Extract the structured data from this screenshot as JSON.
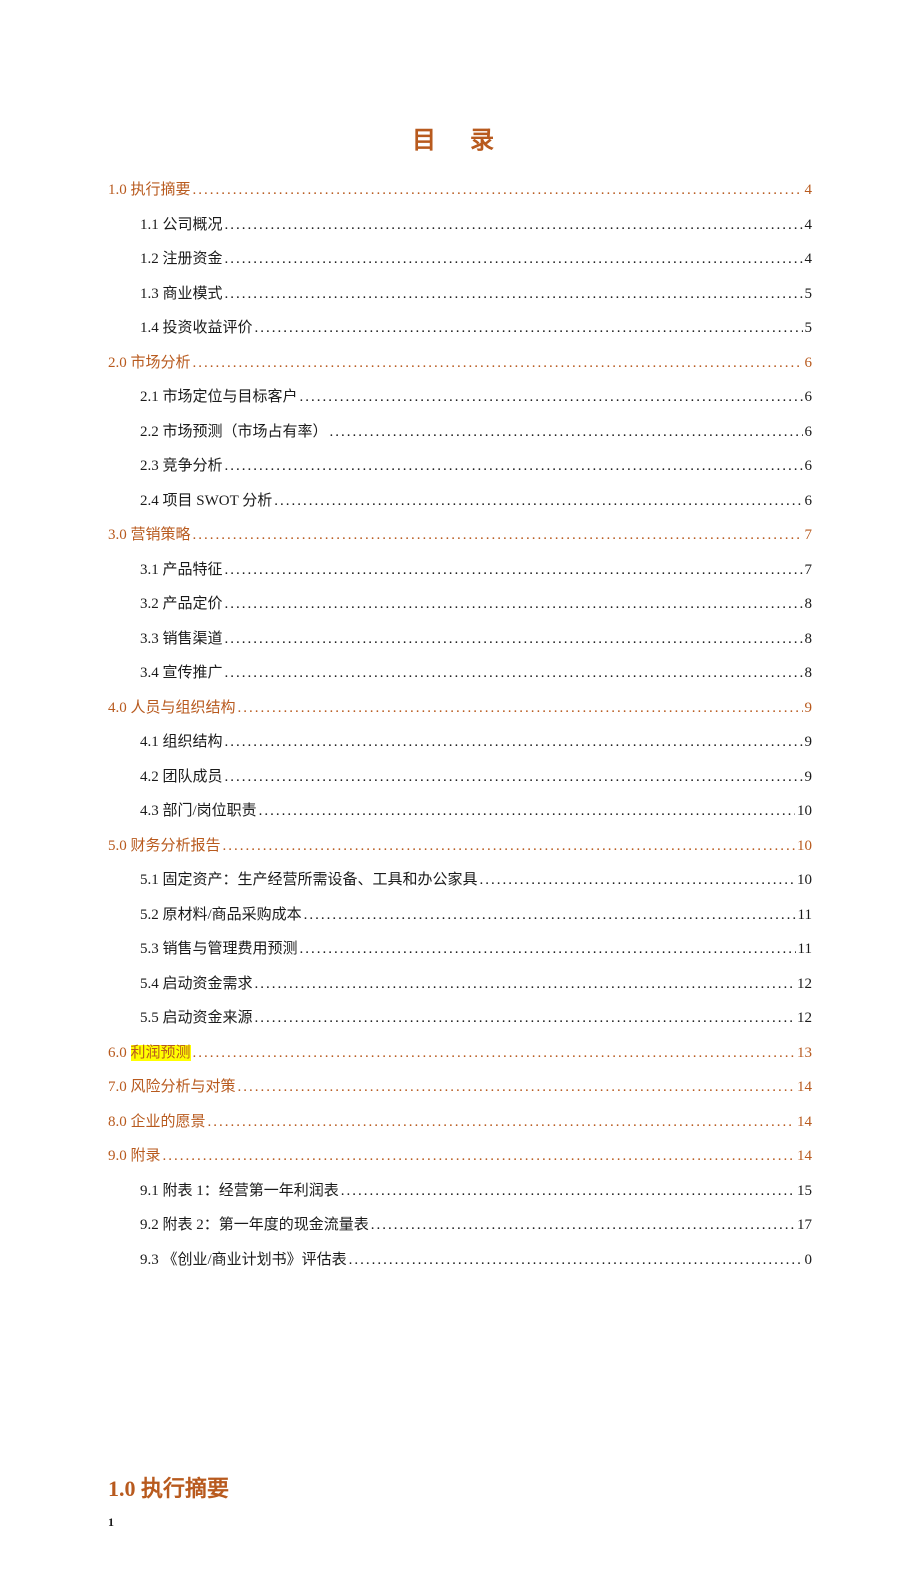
{
  "title": "目 录",
  "entries": [
    {
      "level": 1,
      "label": "1.0 执行摘要",
      "page": "4"
    },
    {
      "level": 2,
      "label": "1.1 公司概况",
      "page": "4"
    },
    {
      "level": 2,
      "label": "1.2 注册资金",
      "page": "4"
    },
    {
      "level": 2,
      "label": "1.3 商业模式",
      "page": "5"
    },
    {
      "level": 2,
      "label": "1.4 投资收益评价",
      "page": "5"
    },
    {
      "level": 1,
      "label": "2.0 市场分析",
      "page": "6"
    },
    {
      "level": 2,
      "label": "2.1 市场定位与目标客户",
      "page": "6"
    },
    {
      "level": 2,
      "label": "2.2 市场预测（市场占有率）",
      "page": "6"
    },
    {
      "level": 2,
      "label": "2.3 竞争分析",
      "page": "6"
    },
    {
      "level": 2,
      "label": "2.4 项目 SWOT 分析",
      "page": "6"
    },
    {
      "level": 1,
      "label": "3.0  营销策略",
      "page": "7"
    },
    {
      "level": 2,
      "label": "3.1 产品特征",
      "page": "7"
    },
    {
      "level": 2,
      "label": "3.2 产品定价",
      "page": "8"
    },
    {
      "level": 2,
      "label": "3.3 销售渠道",
      "page": "8"
    },
    {
      "level": 2,
      "label": "3.4 宣传推广",
      "page": "8"
    },
    {
      "level": 1,
      "label": "4.0 人员与组织结构",
      "page": "9"
    },
    {
      "level": 2,
      "label": "4.1 组织结构",
      "page": "9"
    },
    {
      "level": 2,
      "label": "4.2 团队成员",
      "page": "9"
    },
    {
      "level": 2,
      "label": "4.3 部门/岗位职责",
      "page": "10"
    },
    {
      "level": 1,
      "label": "5.0  财务分析报告",
      "page": "10"
    },
    {
      "level": 2,
      "label": "5.1 固定资产：生产经营所需设备、工具和办公家具",
      "page": "10"
    },
    {
      "level": 2,
      "label": "5.2 原材料/商品采购成本",
      "page": "11"
    },
    {
      "level": 2,
      "label": "5.3 销售与管理费用预测",
      "page": "11"
    },
    {
      "level": 2,
      "label": "5.4 启动资金需求",
      "page": "12"
    },
    {
      "level": 2,
      "label": "5.5 启动资金来源",
      "page": "12"
    },
    {
      "level": 1,
      "label": "6.0 ",
      "highlight": "利润预测",
      "after": "",
      "page": "13"
    },
    {
      "level": 1,
      "label": "7.0 风险分析与对策",
      "page": "14"
    },
    {
      "level": 1,
      "label": "8.0 企业的愿景",
      "page": "14"
    },
    {
      "level": 1,
      "label": "9.0 附录",
      "page": "14"
    },
    {
      "level": 2,
      "label": "9.1 附表 1：经营第一年利润表",
      "page": "15"
    },
    {
      "level": 2,
      "label": "9.2 附表 2：第一年度的现金流量表",
      "page": "17"
    },
    {
      "level": 2,
      "label": "9.3 《创业/商业计划书》评估表",
      "page": "0"
    }
  ],
  "section_heading": "1.0 执行摘要",
  "page_number": "1"
}
